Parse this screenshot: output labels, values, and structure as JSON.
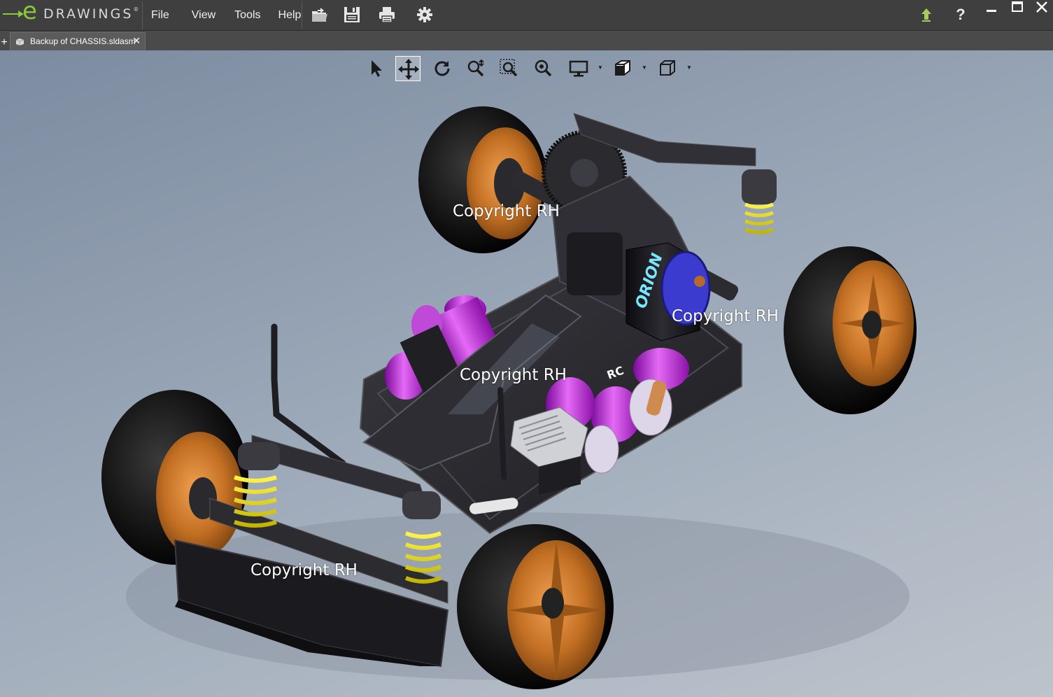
{
  "app": {
    "logo_letter": "e",
    "logo_word": "DRAWINGS",
    "logo_mark": "®",
    "accent_color": "#8cc63f"
  },
  "menu": [
    "File",
    "View",
    "Tools",
    "Help"
  ],
  "toolbar": {
    "icons": [
      "open-icon",
      "save-icon",
      "print-icon",
      "settings-icon"
    ],
    "right_icons": [
      "upgrade-arrow-icon",
      "help-icon"
    ],
    "help_glyph": "?"
  },
  "window_controls": [
    "minimize",
    "maximize",
    "close"
  ],
  "tabs": {
    "new_tab_glyph": "+",
    "items": [
      {
        "label": "Backup of CHASSIS.sldasm",
        "close_glyph": "✕"
      }
    ]
  },
  "view_toolbar": {
    "tools": [
      "select-icon",
      "pan-icon",
      "rotate-icon",
      "zoom-to-fit-icon",
      "zoom-to-area-icon",
      "zoom-icon",
      "display-style-icon",
      "section-view-icon",
      "standard-views-icon"
    ],
    "active_tool": "pan-icon"
  },
  "model": {
    "motor_label": "ORION",
    "battery_label": "RC"
  },
  "watermarks": [
    "Copyright RH",
    "Copyright RH",
    "Copyright RH",
    "Copyright RH"
  ]
}
